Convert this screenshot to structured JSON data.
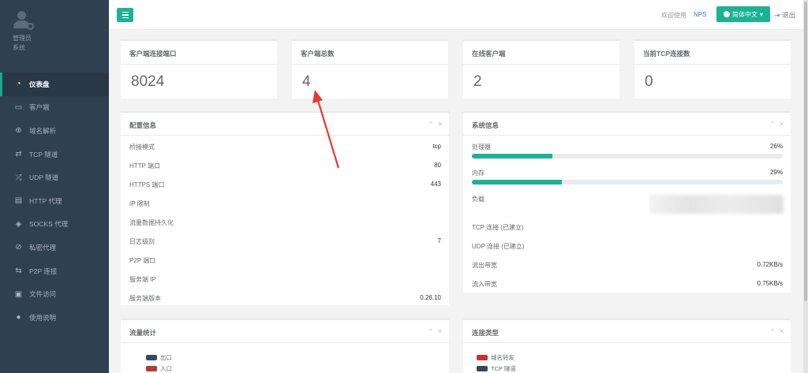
{
  "sidebar": {
    "role": "管理员",
    "sub": "系统",
    "items": [
      {
        "label": "仪表盘",
        "icon": "dashboard-icon",
        "glyph": "◔"
      },
      {
        "label": "客户端",
        "icon": "monitor-icon",
        "glyph": "▭"
      },
      {
        "label": "域名解析",
        "icon": "globe-icon",
        "glyph": "⊕"
      },
      {
        "label": "TCP 隧道",
        "icon": "retweet-icon",
        "glyph": "⇄"
      },
      {
        "label": "UDP 隧道",
        "icon": "random-icon",
        "glyph": "⤮"
      },
      {
        "label": "HTTP 代理",
        "icon": "server-icon",
        "glyph": "▤"
      },
      {
        "label": "SOCKS 代理",
        "icon": "layers-icon",
        "glyph": "◈"
      },
      {
        "label": "私密代理",
        "icon": "eye-slash-icon",
        "glyph": "⊘"
      },
      {
        "label": "P2P 连接",
        "icon": "exchange-icon",
        "glyph": "⇆"
      },
      {
        "label": "文件访问",
        "icon": "briefcase-icon",
        "glyph": "▣"
      },
      {
        "label": "使用说明",
        "icon": "lightbulb-icon",
        "glyph": "●"
      }
    ]
  },
  "topbar": {
    "welcome": "欢迎使用",
    "nps": "NPS",
    "lang": "简体中文",
    "logout": "退出"
  },
  "stats": [
    {
      "title": "客户端连接端口",
      "value": "8024"
    },
    {
      "title": "客户端总数",
      "value": "4"
    },
    {
      "title": "在线客户端",
      "value": "2"
    },
    {
      "title": "当前TCP连接数",
      "value": "0"
    }
  ],
  "config": {
    "title": "配置信息",
    "rows": [
      {
        "k": "桥接模式",
        "v": "tcp"
      },
      {
        "k": "HTTP 端口",
        "v": "80"
      },
      {
        "k": "HTTPS 端口",
        "v": "443"
      },
      {
        "k": "IP 限制",
        "v": ""
      },
      {
        "k": "流量数据持久化",
        "v": ""
      },
      {
        "k": "日志级别",
        "v": "7"
      },
      {
        "k": "P2P 端口",
        "v": ""
      },
      {
        "k": "服务端 IP",
        "v": ""
      },
      {
        "k": "服务端版本",
        "v": "0.26.10"
      }
    ]
  },
  "system": {
    "title": "系统信息",
    "cpu": {
      "label": "处理器",
      "value": "26%",
      "fraction": 0.26
    },
    "mem": {
      "label": "内存",
      "value": "29%",
      "fraction": 0.29
    },
    "load": {
      "label": "负载"
    },
    "rows": [
      {
        "k": "TCP 连接 (已建立)",
        "v": ""
      },
      {
        "k": "UDP 连接 (已建立)",
        "v": ""
      },
      {
        "k": "流出带宽",
        "v": "0.72KB/s"
      },
      {
        "k": "流入带宽",
        "v": "0.75KB/s"
      }
    ]
  },
  "traffic": {
    "title": "流量统计",
    "legend": [
      {
        "label": "出口",
        "color": "#34495e"
      },
      {
        "label": "入口",
        "color": "#c23531"
      }
    ]
  },
  "conntype": {
    "title": "连接类型",
    "legend": [
      {
        "label": "域名转发",
        "color": "#c23531"
      },
      {
        "label": "TCP 隧道",
        "color": "#34495e"
      }
    ]
  },
  "colors": {
    "accent": "#1ab394",
    "sidebar": "#2f4050",
    "annotation_arrow": "#e53935"
  }
}
